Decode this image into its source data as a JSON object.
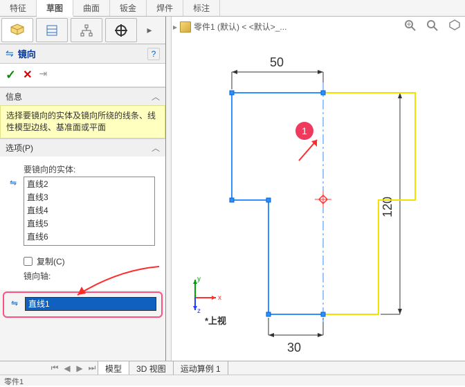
{
  "cmd_tabs": {
    "t0": "特征",
    "t1": "草图",
    "t2": "曲面",
    "t3": "钣金",
    "t4": "焊件",
    "t5": "标注"
  },
  "active_cmd_tab_index": 1,
  "crumb": {
    "part_label": "零件1 (默认) < <默认>_..."
  },
  "pm": {
    "title": "镜向",
    "ok_glyph": "✓",
    "cancel_glyph": "✕",
    "pin_glyph": "⇥",
    "help_glyph": "?"
  },
  "section_info": {
    "hdr": "信息",
    "body": "选择要镜向的实体及镜向所绕的线条、线性模型边线、基准面或平面"
  },
  "section_opts": {
    "hdr": "选项(P)",
    "entities_label": "要镜向的实体:",
    "entities": [
      "直线2",
      "直线3",
      "直线4",
      "直线5",
      "直线6"
    ],
    "copy_label": "复制(C)",
    "axis_label": "镜向轴:",
    "axis_value": "直线1"
  },
  "sketch": {
    "dim_top": "50",
    "dim_right": "120",
    "dim_bottom": "30"
  },
  "annotation": {
    "badge": "1"
  },
  "triad": {
    "x": "x",
    "y": "y",
    "z": "z"
  },
  "view_label": "*上视",
  "bottom_tabs": {
    "t0": "模型",
    "t1": "3D 视图",
    "t2": "运动算例 1"
  },
  "status_text": "零件1"
}
